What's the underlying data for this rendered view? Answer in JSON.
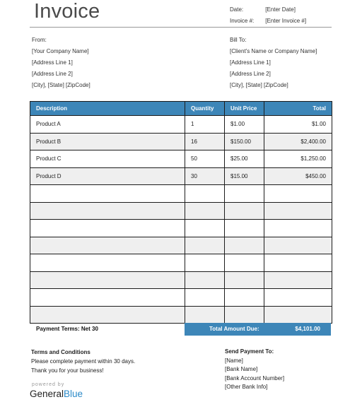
{
  "header": {
    "title": "Invoice",
    "date_label": "Date:",
    "date_value": "[Enter Date]",
    "invoice_label": "Invoice #:",
    "invoice_value": "[Enter Invoice #]"
  },
  "from": {
    "label": "From:",
    "lines": [
      "[Your Company Name]",
      "[Address Line 1]",
      "[Address Line 2]",
      "[City], [State] [ZipCode]"
    ]
  },
  "bill_to": {
    "label": "Bill To:",
    "lines": [
      "[Client's Name or Company Name]",
      "[Address Line 1]",
      "[Address Line 2]",
      "[City], [State] [ZipCode]"
    ]
  },
  "table": {
    "headers": [
      "Description",
      "Quantity",
      "Unit Price",
      "Total"
    ],
    "rows": [
      [
        "Product A",
        "1",
        "$1.00",
        "$1.00"
      ],
      [
        "Product B",
        "16",
        "$150.00",
        "$2,400.00"
      ],
      [
        "Product C",
        "50",
        "$25.00",
        "$1,250.00"
      ],
      [
        "Product D",
        "30",
        "$15.00",
        "$450.00"
      ],
      [
        "",
        "",
        "",
        ""
      ],
      [
        "",
        "",
        "",
        ""
      ],
      [
        "",
        "",
        "",
        ""
      ],
      [
        "",
        "",
        "",
        ""
      ],
      [
        "",
        "",
        "",
        ""
      ],
      [
        "",
        "",
        "",
        ""
      ],
      [
        "",
        "",
        "",
        ""
      ],
      [
        "",
        "",
        "",
        ""
      ]
    ]
  },
  "summary": {
    "payment_terms": "Payment Terms: Net 30",
    "total_label": "Total Amount Due:",
    "total_value": "$4,101.00"
  },
  "terms": {
    "heading": "Terms and Conditions",
    "lines": [
      "Please complete payment within 30 days.",
      "Thank you for your business!"
    ]
  },
  "send_payment": {
    "heading": "Send Payment To:",
    "lines": [
      "[Name]",
      "[Bank Name]",
      "[Bank Account Number]",
      "[Other Bank Info]"
    ]
  },
  "branding": {
    "powered_by": "powered by",
    "brand_part1": "General",
    "brand_part2": "Blue"
  },
  "colors": {
    "accent": "#3d86b8",
    "brand_blue": "#2b8ac8",
    "alt_row": "#efefef"
  }
}
